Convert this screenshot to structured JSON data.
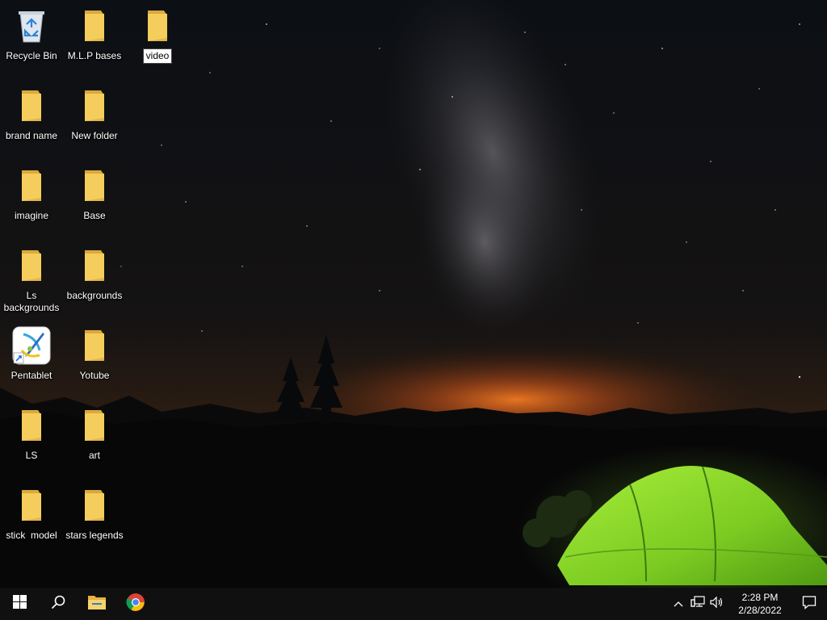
{
  "desktop": {
    "icons": [
      {
        "label": "Recycle Bin",
        "icon": "recycle-bin-icon"
      },
      {
        "label": "M.L.P bases",
        "icon": "folder-icon"
      },
      {
        "label": "video",
        "icon": "folder-icon",
        "state": "renaming"
      },
      {
        "label": "brand name",
        "icon": "folder-icon"
      },
      {
        "label": "New folder",
        "icon": "folder-icon"
      },
      {
        "label": "imagine",
        "icon": "folder-icon"
      },
      {
        "label": "Base",
        "icon": "folder-icon"
      },
      {
        "label": "Ls backgrounds",
        "icon": "folder-icon"
      },
      {
        "label": "backgrounds",
        "icon": "folder-icon"
      },
      {
        "label": "Pentablet",
        "icon": "pentablet-shortcut-icon"
      },
      {
        "label": "Yotube",
        "icon": "folder-icon"
      },
      {
        "label": "LS",
        "icon": "folder-icon"
      },
      {
        "label": "art",
        "icon": "folder-icon"
      },
      {
        "label": "stick  model",
        "icon": "folder-icon"
      },
      {
        "label": "stars legends",
        "icon": "folder-icon"
      }
    ]
  },
  "taskbar": {
    "pinned": [
      "start-icon",
      "search-icon",
      "file-explorer-icon",
      "chrome-icon"
    ],
    "tray": {
      "icons": [
        "chevron-up-icon",
        "network-icon",
        "volume-icon"
      ],
      "time": "2:28 PM",
      "date": "2/28/2022"
    }
  },
  "colors": {
    "taskbar": "#101010",
    "folder": "#f5cd5c",
    "tent": "#8fdd2a",
    "horizon_glow": "#e0621c"
  }
}
